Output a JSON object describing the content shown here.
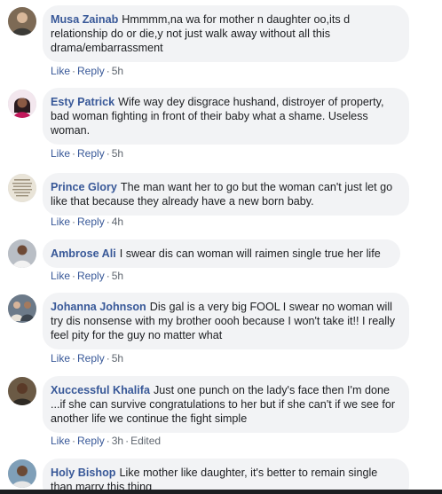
{
  "comments": [
    {
      "author": "Musa Zainab",
      "text": "Hmmmm,na wa for mother n daughter oo,its d relationship do or die,y not just walk away without all this drama/embarrassment",
      "actions": {
        "like": "Like",
        "reply": "Reply",
        "time": "5h",
        "edited": ""
      },
      "avatar_icon": "person-avatar-icon",
      "avatar_color": "#7d6a55"
    },
    {
      "author": "Esty Patrick",
      "text": "Wife way dey disgrace hushand, distroyer of property, bad woman fighting in front of their baby what a shame. Useless woman.",
      "actions": {
        "like": "Like",
        "reply": "Reply",
        "time": "5h",
        "edited": ""
      },
      "avatar_icon": "person-avatar-icon",
      "avatar_color": "#c2185b"
    },
    {
      "author": "Prince Glory",
      "text": "The man want her to go but the woman can't just let go like that because they already have a new born baby.",
      "actions": {
        "like": "Like",
        "reply": "Reply",
        "time": "4h",
        "edited": ""
      },
      "avatar_icon": "text-avatar-icon",
      "avatar_color": "#e9e4d8"
    },
    {
      "author": "Ambrose Ali",
      "text": "I swear dis can woman will raimen single true her life",
      "actions": {
        "like": "Like",
        "reply": "Reply",
        "time": "5h",
        "edited": ""
      },
      "avatar_icon": "person-avatar-icon",
      "avatar_color": "#8a8f96"
    },
    {
      "author": "Johanna Johnson",
      "text": "Dis gal is a very big FOOL I swear no woman will try dis nonsense with my brother oooh because I won't take it!! I really feel pity for the guy no matter what",
      "actions": {
        "like": "Like",
        "reply": "Reply",
        "time": "5h",
        "edited": ""
      },
      "avatar_icon": "group-avatar-icon",
      "avatar_color": "#6c7a89"
    },
    {
      "author": "Xuccessful Khalifa",
      "text": "Just one punch on the lady's face then I'm done ...if she can survive congratulations to her but if she can't if we see for another life we continue the fight simple",
      "actions": {
        "like": "Like",
        "reply": "Reply",
        "time": "3h",
        "edited": "Edited"
      },
      "avatar_icon": "person-avatar-icon",
      "avatar_color": "#6b5a45"
    },
    {
      "author": "Holy Bishop",
      "text": "Like mother like daughter, it's better to remain single than marry this thing",
      "actions": {
        "like": "",
        "reply": "",
        "time": "",
        "edited": ""
      },
      "avatar_icon": "person-avatar-icon",
      "avatar_color": "#7f9fb8"
    }
  ]
}
